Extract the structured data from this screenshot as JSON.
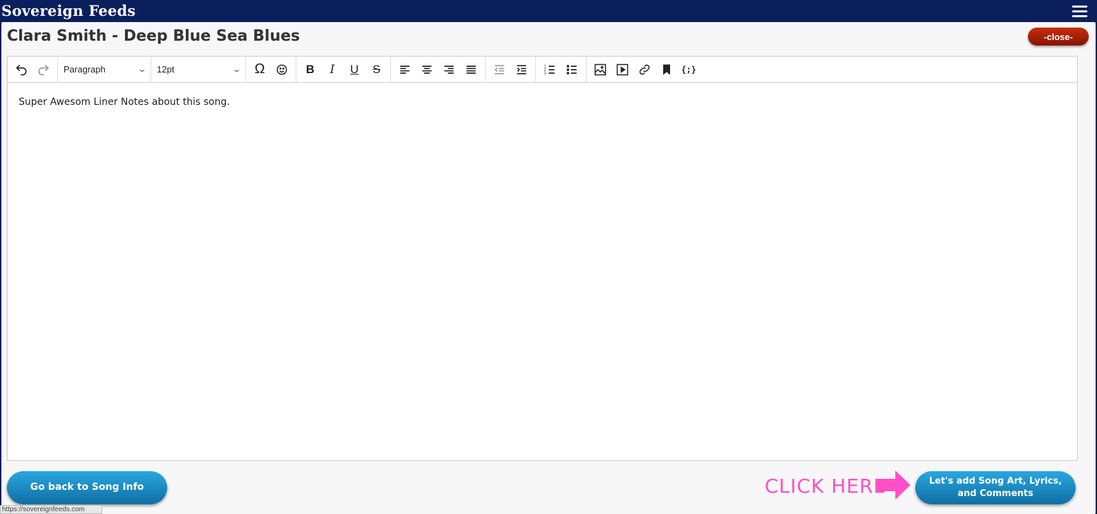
{
  "app": {
    "brand": "Sovereign Feeds"
  },
  "header": {
    "title": "Clara Smith - Deep Blue Sea Blues",
    "close_label": "-close-"
  },
  "toolbar": {
    "block_format": "Paragraph",
    "font_size": "12pt"
  },
  "editor": {
    "content": "Super Awesom Liner Notes about this song."
  },
  "footer": {
    "back_label": "Go back to Song Info",
    "cta_text": "CLICK HERE",
    "next_label_line1": "Let's add Song Art, Lyrics,",
    "next_label_line2": "and Comments"
  },
  "status": {
    "url": "https://sovereignfeeds.com"
  },
  "colors": {
    "navbar": "#0a1f5c",
    "accent_blue": "#1b8fc9",
    "close_red": "#a81e06",
    "cta_pink": "#ff4fc8"
  }
}
